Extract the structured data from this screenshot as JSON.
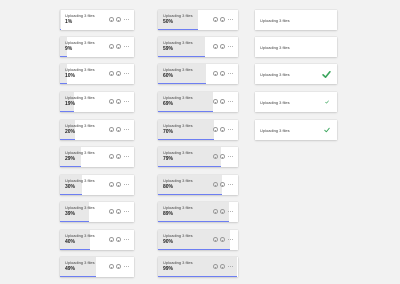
{
  "colors": {
    "background": "#f2f2f2",
    "card": "#ffffff",
    "progress_bar": "#6d7ef2",
    "progress_fill": "#e8e8e8",
    "check": "#3aa55c"
  },
  "icons": {
    "pause": "pause-circle-icon",
    "cancel": "cancel-circle-icon",
    "more": "more-dots-icon",
    "done": "checkmark-icon"
  },
  "column_left": [
    {
      "title": "Uploading 3 files",
      "percent": "1%",
      "progress": 1
    },
    {
      "title": "Uploading 3 files",
      "percent": "9%",
      "progress": 9
    },
    {
      "title": "Uploading 3 files",
      "percent": "10%",
      "progress": 10
    },
    {
      "title": "Uploading 3 files",
      "percent": "19%",
      "progress": 19
    },
    {
      "title": "Uploading 3 files",
      "percent": "20%",
      "progress": 20
    },
    {
      "title": "Uploading 3 files",
      "percent": "29%",
      "progress": 29
    },
    {
      "title": "Uploading 3 files",
      "percent": "30%",
      "progress": 30
    },
    {
      "title": "Uploading 3 files",
      "percent": "39%",
      "progress": 39
    },
    {
      "title": "Uploading 3 files",
      "percent": "40%",
      "progress": 40
    },
    {
      "title": "Uploading 3 files",
      "percent": "49%",
      "progress": 49
    }
  ],
  "column_middle": [
    {
      "title": "Uploading 3 files",
      "percent": "50%",
      "progress": 50
    },
    {
      "title": "Uploading 3 files",
      "percent": "59%",
      "progress": 59
    },
    {
      "title": "Uploading 3 files",
      "percent": "60%",
      "progress": 60
    },
    {
      "title": "Uploading 3 files",
      "percent": "69%",
      "progress": 69
    },
    {
      "title": "Uploading 3 files",
      "percent": "70%",
      "progress": 70
    },
    {
      "title": "Uploading 3 files",
      "percent": "79%",
      "progress": 79
    },
    {
      "title": "Uploading 3 files",
      "percent": "80%",
      "progress": 80
    },
    {
      "title": "Uploading 3 files",
      "percent": "89%",
      "progress": 89
    },
    {
      "title": "Uploading 3 files",
      "percent": "90%",
      "progress": 90
    },
    {
      "title": "Uploading 3 files",
      "percent": "99%",
      "progress": 99
    }
  ],
  "column_right": [
    {
      "title": "Uploading 3 files",
      "check": "none"
    },
    {
      "title": "Uploading 3 files",
      "check": "none"
    },
    {
      "title": "Uploading 3 files",
      "check": "large"
    },
    {
      "title": "Uploading 3 files",
      "check": "small"
    },
    {
      "title": "Uploading 3 files",
      "check": "medium"
    }
  ]
}
